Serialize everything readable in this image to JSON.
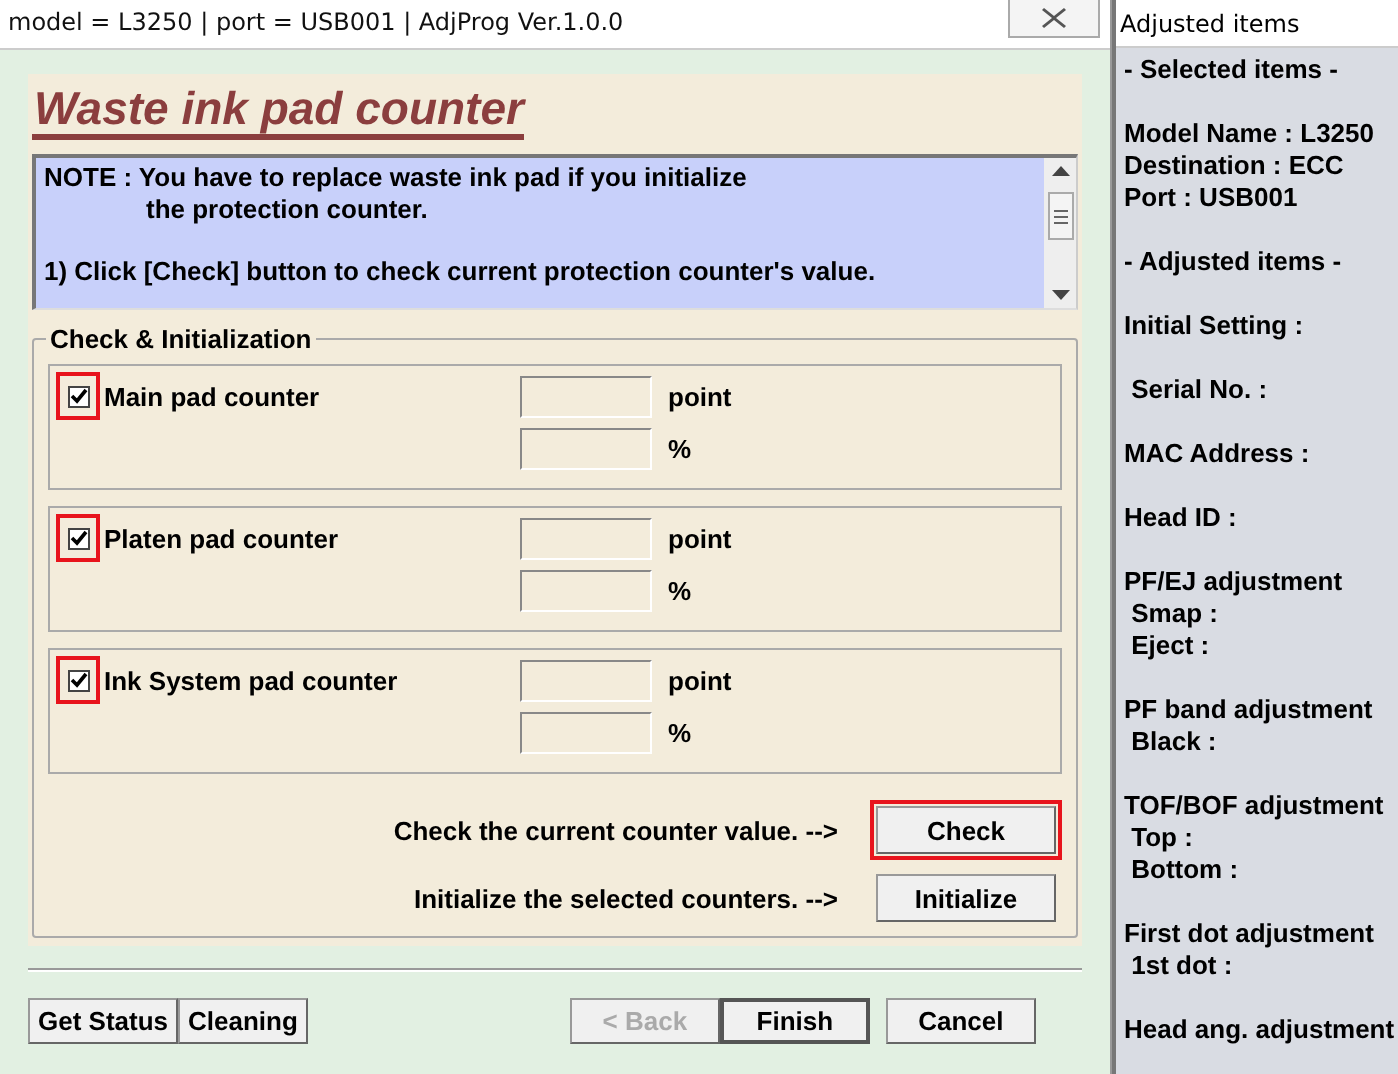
{
  "window": {
    "title": "model = L3250 | port = USB001 | AdjProg Ver.1.0.0"
  },
  "heading": "Waste ink pad counter",
  "note": {
    "lines": [
      {
        "kind": "plain",
        "text": "NOTE : You have to replace waste ink pad if you initialize"
      },
      {
        "kind": "indent",
        "text": "the protection counter."
      },
      {
        "kind": "gap"
      },
      {
        "kind": "plain",
        "text": "1) Click [Check] button to check current protection counter's value."
      }
    ]
  },
  "group": {
    "title": "Check & Initialization",
    "counters": [
      {
        "label": "Main pad counter",
        "checked": true,
        "highlighted": true,
        "units": [
          "point",
          "%"
        ]
      },
      {
        "label": "Platen pad counter",
        "checked": true,
        "highlighted": true,
        "units": [
          "point",
          "%"
        ]
      },
      {
        "label": "Ink System pad counter",
        "checked": true,
        "highlighted": true,
        "units": [
          "point",
          "%"
        ]
      }
    ],
    "actions": [
      {
        "hint": "Check the current counter value. -->",
        "button": "Check",
        "highlighted": true
      },
      {
        "hint": "Initialize the selected counters. -->",
        "button": "Initialize",
        "highlighted": false
      }
    ]
  },
  "buttons": [
    {
      "label": "Get Status",
      "disabled": false,
      "default": false
    },
    {
      "label": "Cleaning",
      "disabled": false,
      "default": false
    },
    {
      "label": "< Back",
      "disabled": true,
      "default": false
    },
    {
      "label": "Finish",
      "disabled": false,
      "default": true
    },
    {
      "label": "Cancel",
      "disabled": false,
      "default": false
    }
  ],
  "side_panel": {
    "title": "Adjusted items",
    "groups": [
      [
        "- Selected items -"
      ],
      [
        "Model Name : L3250",
        "Destination : ECC",
        "Port : USB001"
      ],
      [
        "- Adjusted items -"
      ],
      [
        "Initial Setting :"
      ],
      [
        " Serial No. :"
      ],
      [
        "MAC Address :"
      ],
      [
        "Head ID :"
      ],
      [
        "PF/EJ adjustment",
        " Smap :",
        " Eject :"
      ],
      [
        "PF band adjustment",
        " Black :"
      ],
      [
        "TOF/BOF adjustment",
        " Top :",
        " Bottom :"
      ],
      [
        "First dot adjustment",
        " 1st dot :"
      ],
      [
        "Head ang. adjustment"
      ]
    ]
  }
}
